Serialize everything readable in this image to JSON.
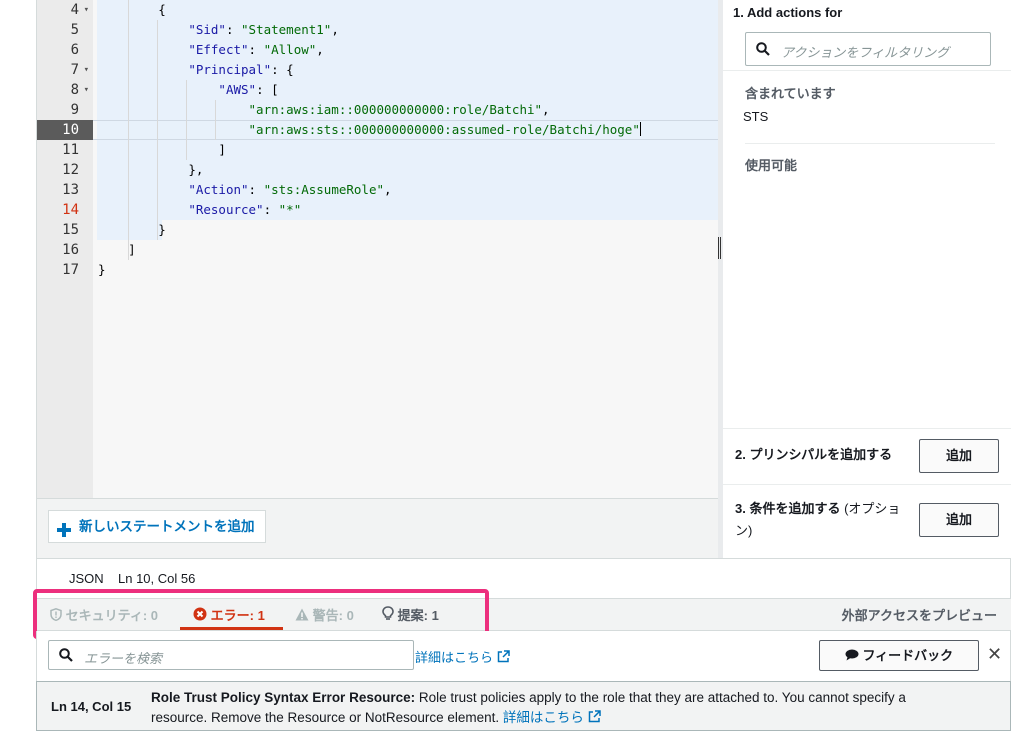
{
  "editor": {
    "lines": [
      {
        "n": "4",
        "fold": true
      },
      {
        "n": "5"
      },
      {
        "n": "6"
      },
      {
        "n": "7",
        "fold": true
      },
      {
        "n": "8",
        "fold": true
      },
      {
        "n": "9"
      },
      {
        "n": "10",
        "active": true
      },
      {
        "n": "11"
      },
      {
        "n": "12"
      },
      {
        "n": "13"
      },
      {
        "n": "14",
        "error": true
      },
      {
        "n": "15"
      },
      {
        "n": "16"
      },
      {
        "n": "17"
      }
    ],
    "code": {
      "l4": "{",
      "l5_key": "\"Sid\"",
      "l5_val": "\"Statement1\"",
      "l6_key": "\"Effect\"",
      "l6_val": "\"Allow\"",
      "l7_key": "\"Principal\"",
      "l7_rest": ": {",
      "l8_key": "\"AWS\"",
      "l8_rest": ": [",
      "l9_val": "\"arn:aws:iam::000000000000:role/Batchi\"",
      "l10_val": "\"arn:aws:sts::000000000000:assumed-role/Batchi/hoge\"",
      "l11": "]",
      "l12": "},",
      "l13_key": "\"Action\"",
      "l13_val": "\"sts:AssumeRole\"",
      "l14_key": "\"Resource\"",
      "l14_val": "\"*\"",
      "l15": "}",
      "l16": "]",
      "l17": "}"
    }
  },
  "right_panel": {
    "title": "1. Add actions for",
    "filter_placeholder": "アクションをフィルタリング",
    "included_label": "含まれています",
    "included_item": "STS",
    "available_label": "使用可能",
    "step2_label": "2. プリンシパルを追加する",
    "step2_button": "追加",
    "step3_label": "3. 条件を追加する",
    "step3_optional_a": "(オプショ",
    "step3_optional_b": "ン)",
    "step3_button": "追加"
  },
  "add_statement": {
    "label": "新しいステートメントを追加"
  },
  "status": {
    "mode": "JSON",
    "position": "Ln 10, Col 56"
  },
  "validator": {
    "security": "セキュリティ: 0",
    "errors": "エラー: 1",
    "warnings": "警告: 0",
    "suggestions": "提案: 1",
    "preview": "外部アクセスをプレビュー",
    "search_placeholder": "エラーを検索",
    "learn_more": "詳細はこちら",
    "feedback": "フィードバック"
  },
  "error_detail": {
    "location": "Ln 14, Col 15",
    "title": "Role Trust Policy Syntax Error Resource:",
    "message": " Role trust policies apply to the role that they are attached to. You cannot specify a resource. Remove the Resource or NotResource element. ",
    "link": "詳細はこちら"
  },
  "colors": {
    "accent": "#0073bb",
    "error": "#d13212",
    "highlight": "#ec2f7d"
  }
}
